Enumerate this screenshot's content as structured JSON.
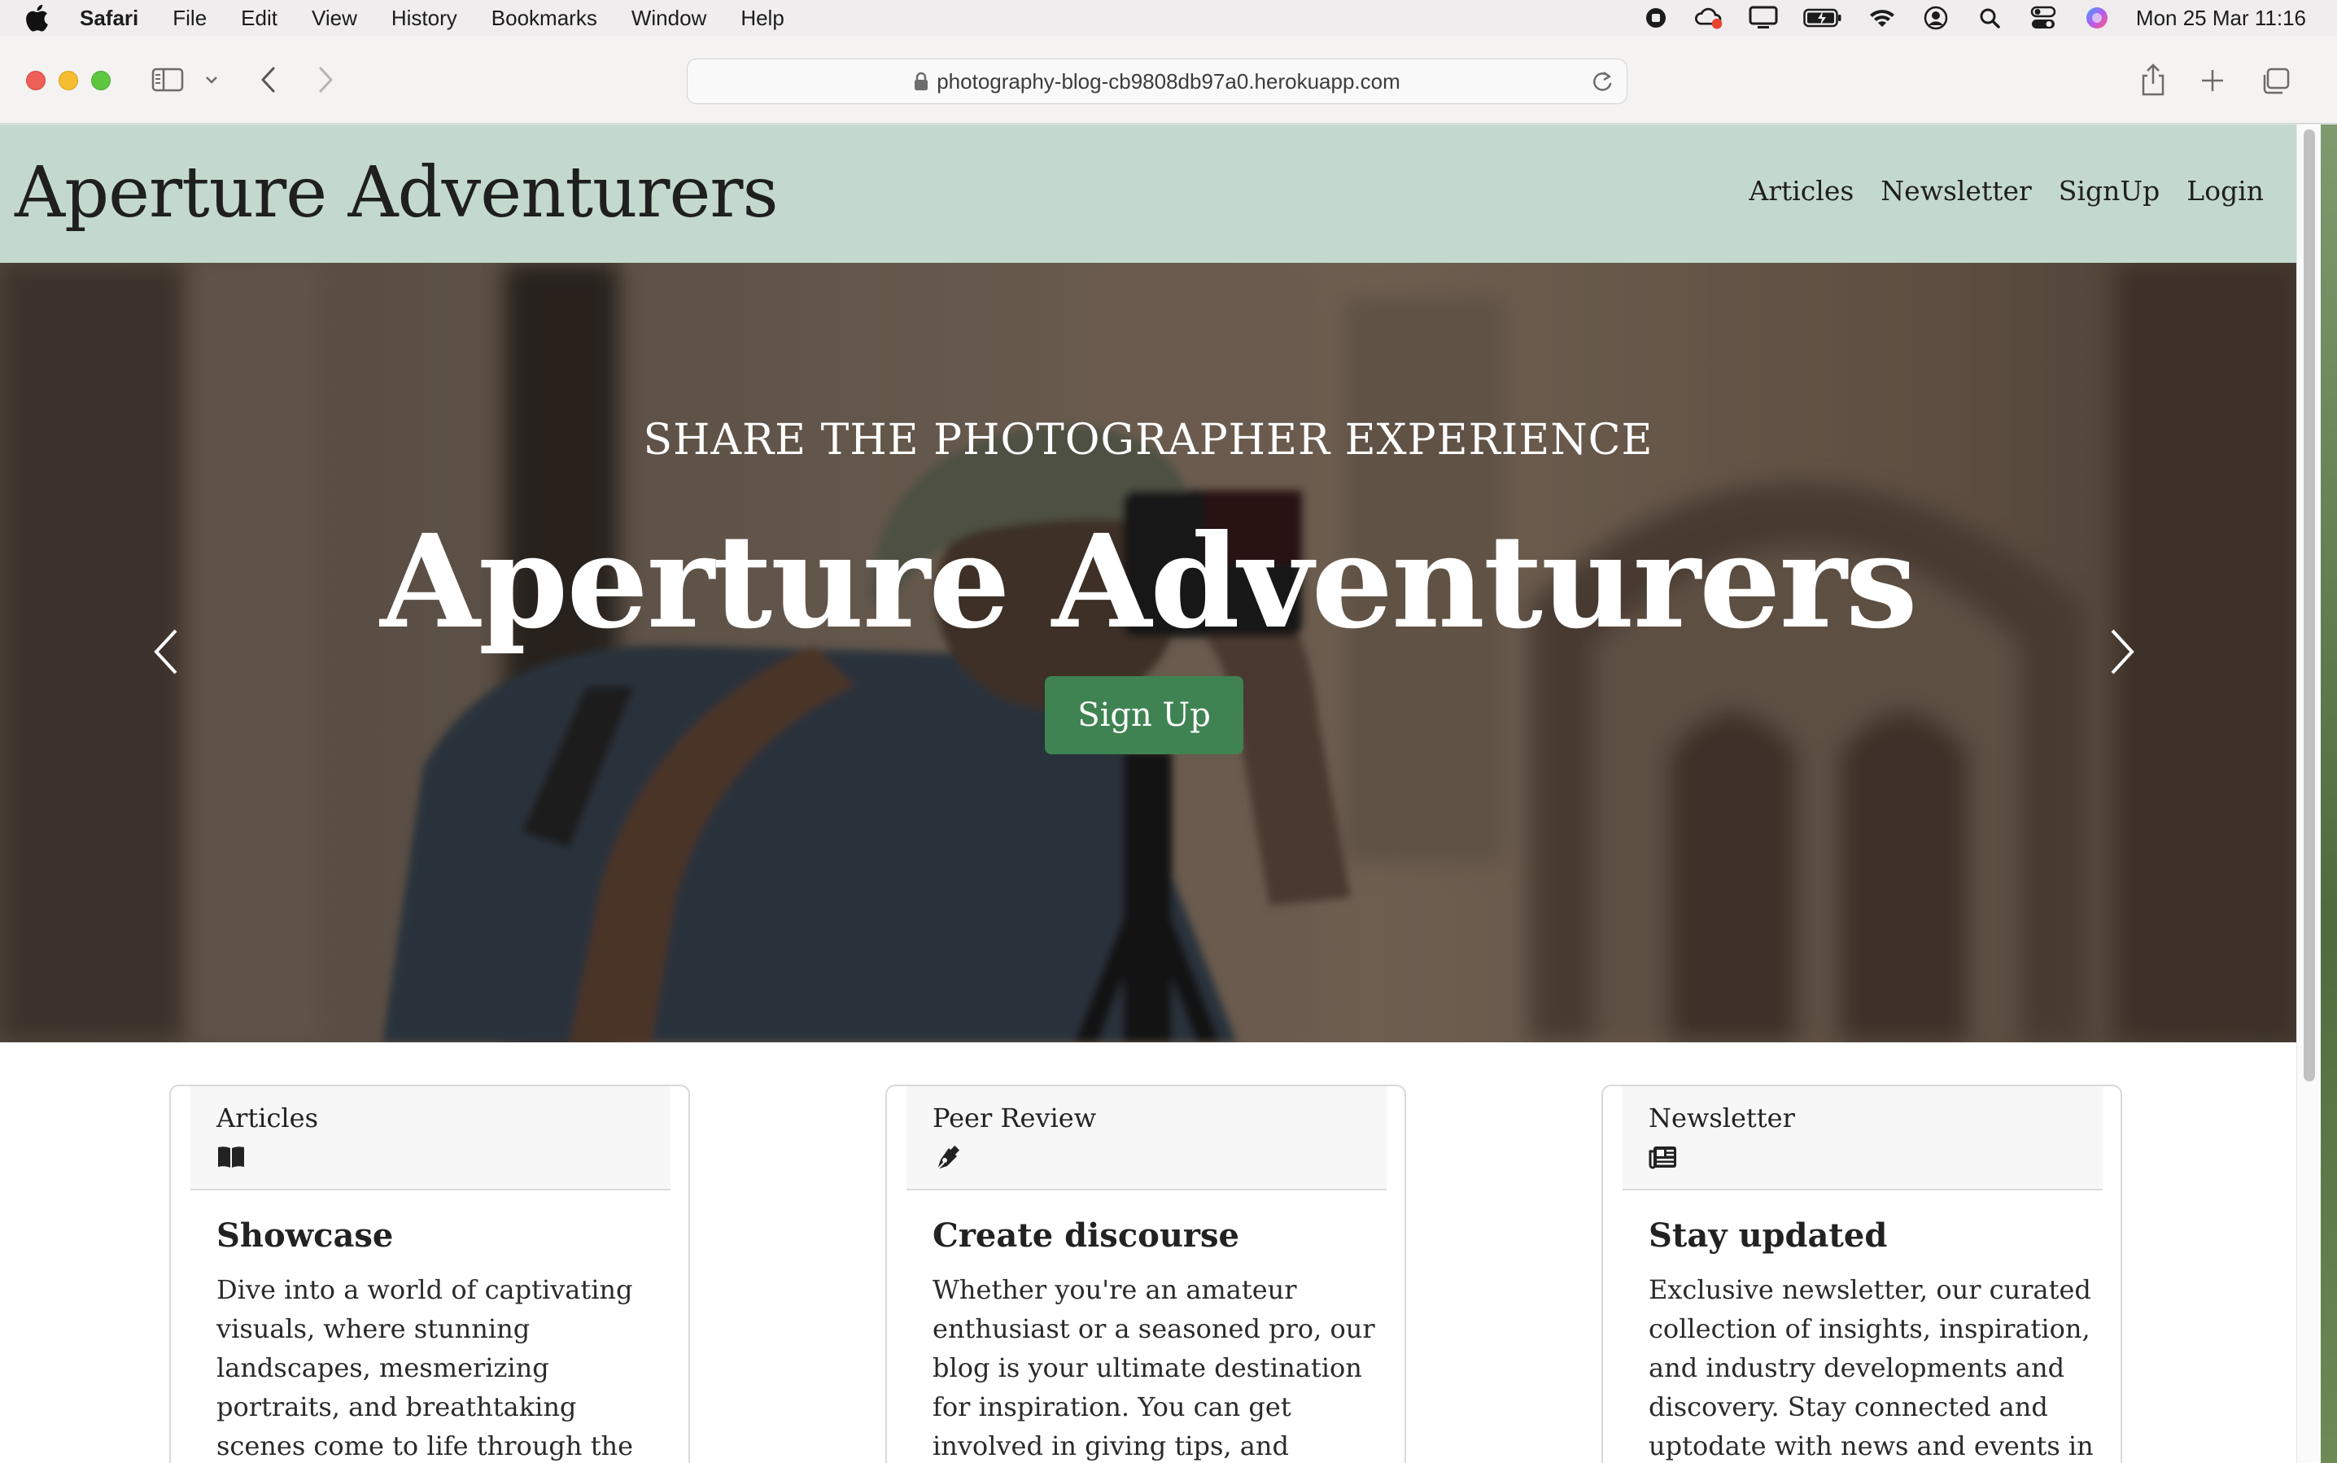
{
  "menubar": {
    "app": "Safari",
    "items": [
      "File",
      "Edit",
      "View",
      "History",
      "Bookmarks",
      "Window",
      "Help"
    ],
    "clock": "Mon 25 Mar  11:16",
    "status_icons": [
      "record-icon",
      "creative-cloud-icon",
      "display-icon",
      "battery-icon",
      "wifi-icon",
      "user-icon",
      "spotlight-icon",
      "control-center-icon",
      "siri-icon"
    ]
  },
  "browser": {
    "url": "photography-blog-cb9808db97a0.herokuapp.com"
  },
  "site": {
    "brand": "Aperture Adventurers",
    "nav": [
      "Articles",
      "Newsletter",
      "SignUp",
      "Login"
    ],
    "colors": {
      "nav_bg": "#c4d9cd",
      "button": "#3f8353"
    }
  },
  "hero": {
    "subtitle": "SHARE THE PHOTOGRAPHER EXPERIENCE",
    "title": "Aperture Adventurers",
    "button": "Sign Up",
    "slides": 3,
    "active_slide": 1
  },
  "cards": [
    {
      "header": "Articles",
      "icon": "book-open-icon",
      "title": "Showcase",
      "text": "Dive into a world of captivating visuals, where stunning landscapes, mesmerizing portraits, and breathtaking scenes come to life through the lens of our passionate"
    },
    {
      "header": "Peer Review",
      "icon": "pen-nib-icon",
      "title": "Create discourse",
      "text": "Whether you're an amateur enthusiast or a seasoned pro, our blog is your ultimate destination for inspiration. You can get involved in giving tips, and techniques to"
    },
    {
      "header": "Newsletter",
      "icon": "newspaper-icon",
      "title": "Stay updated",
      "text": "Exclusive newsletter, our curated collection of insights, inspiration, and industry developments and discovery. Stay connected and uptodate with news and events in"
    }
  ]
}
